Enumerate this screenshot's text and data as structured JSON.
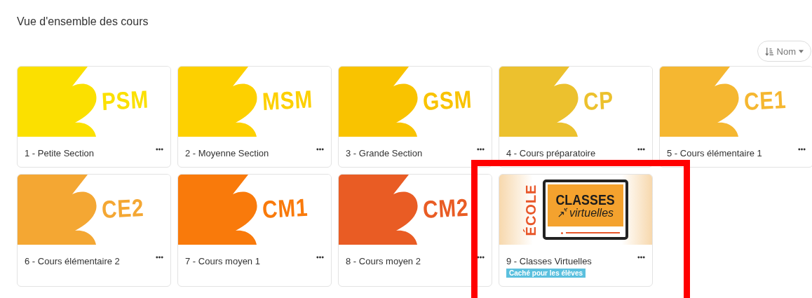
{
  "heading": "Vue d'ensemble des cours",
  "sort": {
    "label": "Nom"
  },
  "courses": [
    {
      "kind": "level",
      "name": "1 - Petite Section",
      "image_label": "PSM",
      "color": "#fbe000"
    },
    {
      "kind": "level",
      "name": "2 - Moyenne Section",
      "image_label": "MSM",
      "color": "#fdd000"
    },
    {
      "kind": "level",
      "name": "3 - Grande Section",
      "image_label": "GSM",
      "color": "#f9c300"
    },
    {
      "kind": "level",
      "name": "4 - Cours préparatoire",
      "image_label": "CP",
      "color": "#ecc12e"
    },
    {
      "kind": "level",
      "name": "5 - Cours élémentaire 1",
      "image_label": "CE1",
      "color": "#f5b731"
    },
    {
      "kind": "level",
      "name": "6 - Cours élémentaire 2",
      "image_label": "CE2",
      "color": "#f4a733"
    },
    {
      "kind": "level",
      "name": "7 - Cours moyen 1",
      "image_label": "CM1",
      "color": "#f97a0b"
    },
    {
      "kind": "level",
      "name": "8 - Cours moyen 2",
      "image_label": "CM2",
      "color": "#e95c24"
    },
    {
      "kind": "virtual",
      "name": "9 - Classes Virtuelles",
      "side_label": "ÉCOLE",
      "screen_title": "CLASSES",
      "screen_subtitle": "virtuelles",
      "badge": "Caché pour les élèves"
    }
  ],
  "highlight": {
    "kind": "frame"
  }
}
